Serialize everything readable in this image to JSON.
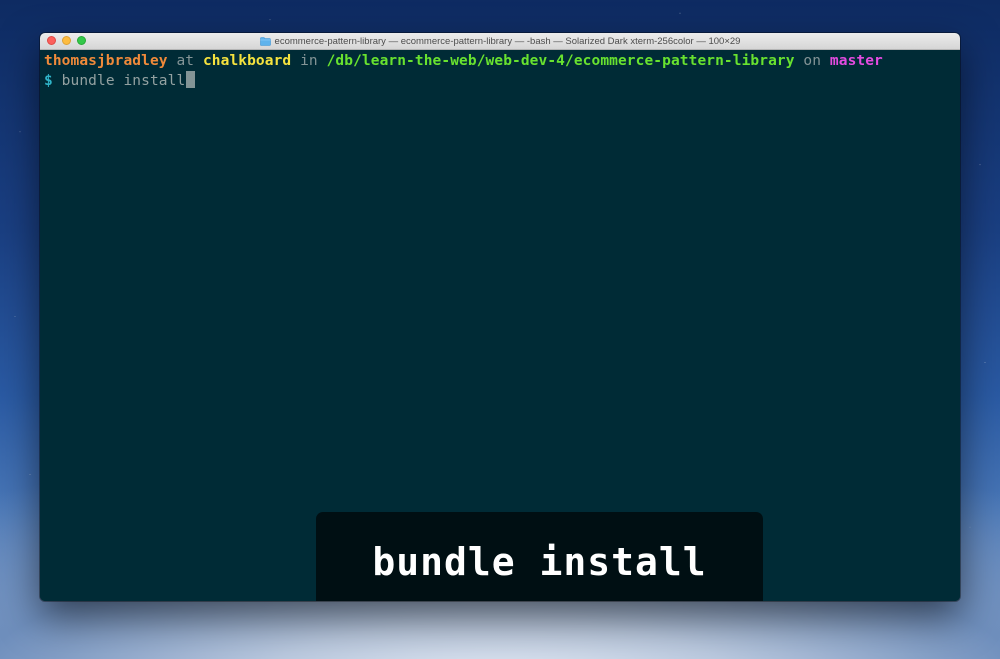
{
  "window": {
    "title": "ecommerce-pattern-library — ecommerce-pattern-library — -bash — Solarized Dark xterm-256color — 100×29",
    "title_icon": "folder-icon"
  },
  "terminal": {
    "prompt_line": {
      "user": "thomasjbradley",
      "at": " at ",
      "host": "chalkboard",
      "in": " in ",
      "path": "/db/learn-the-web/web-dev-4/ecommerce-pattern-library",
      "on": " on ",
      "branch": "master"
    },
    "command_line": {
      "prompt_symbol": "$",
      "command": " bundle install"
    }
  },
  "caption": {
    "text": "bundle install"
  },
  "colors": {
    "terminal_bg": "#002b36",
    "user": "#f08a3a",
    "host": "#f5e23e",
    "path": "#68e22f",
    "branch": "#e34be0",
    "prompt": "#2fb4c8",
    "caption_bg": "#000f13"
  }
}
